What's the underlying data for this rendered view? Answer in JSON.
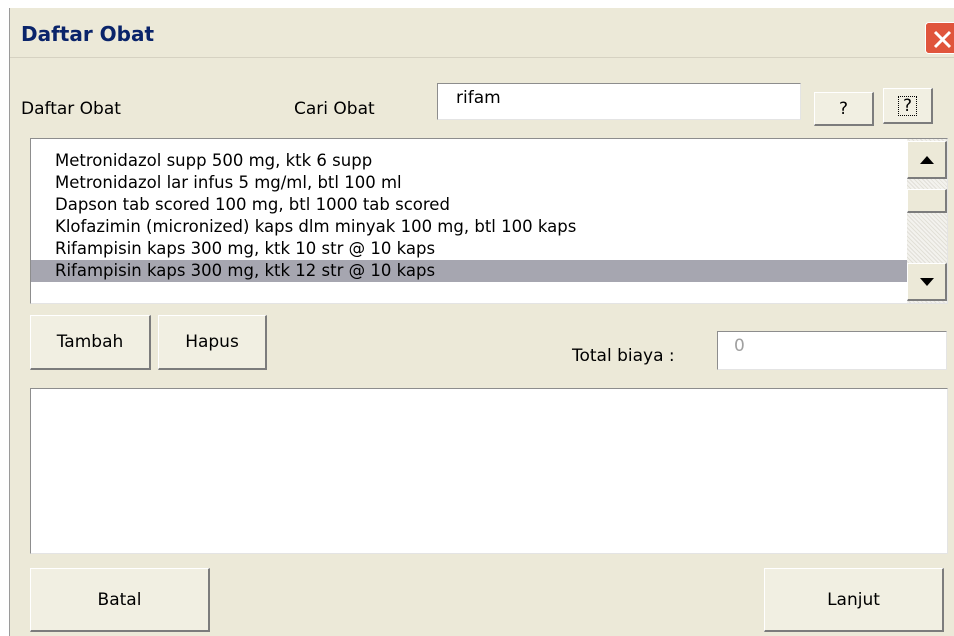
{
  "window": {
    "title": "Daftar Obat",
    "close_icon": "close-icon",
    "close_color": "#e0553c"
  },
  "labels": {
    "list_label": "Daftar Obat",
    "search_label": "Cari Obat",
    "total_label": "Total biaya :"
  },
  "search": {
    "value": "rifam"
  },
  "buttons": {
    "help_1": "?",
    "help_2": "?",
    "add": "Tambah",
    "delete": "Hapus",
    "cancel": "Batal",
    "next": "Lanjut"
  },
  "drug_list": {
    "items": [
      "Metronidazol supp 500 mg, ktk 6 supp",
      "Metronidazol lar infus 5 mg/ml, btl 100 ml",
      "Dapson tab scored 100 mg, btl 1000 tab scored",
      "Klofazimin (micronized) kaps dlm minyak 100 mg, btl 100 kaps",
      "Rifampisin  kaps 300 mg, ktk 10 str @ 10 kaps",
      "Rifampisin  kaps 300 mg, ktk 12 str @ 10 kaps"
    ],
    "selected_index": 5,
    "selected_color": "#a6a6b0",
    "scrollbar_icons": [
      "scroll-up-arrow-icon",
      "scroll-down-arrow-icon"
    ]
  },
  "total": {
    "value": "0"
  }
}
